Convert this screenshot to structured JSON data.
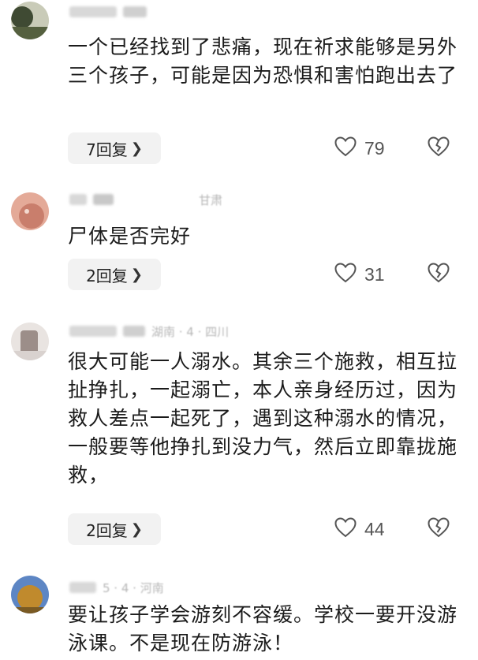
{
  "comments": [
    {
      "meta_text": "",
      "body": "一个已经找到了悲痛，现在祈求能够是另外三个孩子，可能是因为恐惧和害怕跑出去了",
      "replies_label": "7回复",
      "likes": "79",
      "avatar_colors": [
        "#3f4a33",
        "#c9cbb8"
      ]
    },
    {
      "meta_text": "甘肃",
      "body": "尸体是否完好",
      "replies_label": "2回复",
      "likes": "31",
      "avatar_colors": [
        "#e4aa98",
        "#c97e6c"
      ]
    },
    {
      "meta_text": "湖南 · 4 · 四川",
      "body": "很大可能一人溺水。其余三个施救，相互拉扯挣扎，一起溺亡，本人亲身经历过，因为救人差点一起死了，遇到这种溺水的情况，一般要等他挣扎到没力气，然后立即靠拢施救，",
      "replies_label": "2回复",
      "likes": "44",
      "avatar_colors": [
        "#d9d2cf",
        "#9c8e89"
      ]
    },
    {
      "meta_text": "5 · 4 · 河南",
      "body": "要让孩子学会游刻不容缓。学校一要开没游泳课。不是现在防游泳！",
      "replies_label": "",
      "likes": "",
      "avatar_colors": [
        "#5d86c4",
        "#c08a2d"
      ]
    }
  ],
  "icons": {
    "like": "heart-outline-icon",
    "dislike": "broken-heart-icon",
    "chevron": "chevron-right-icon"
  },
  "colors": {
    "reply_bg": "#f2f2f2",
    "icon_stroke": "#555555",
    "text": "#1b1b1b"
  }
}
